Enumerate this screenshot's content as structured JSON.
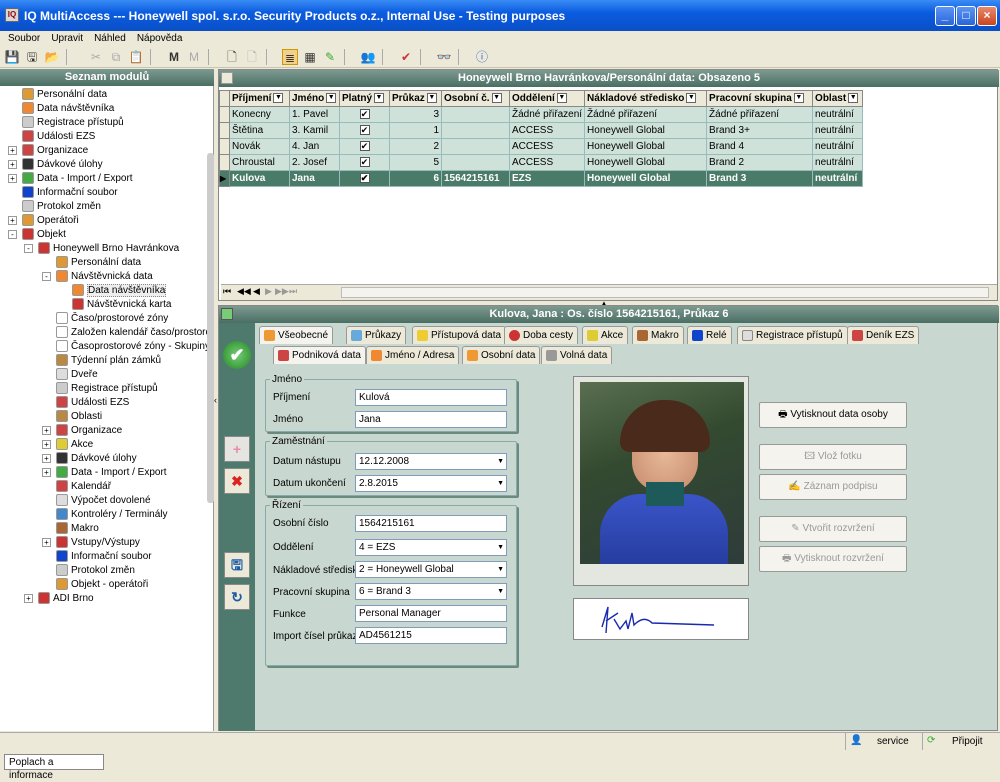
{
  "window": {
    "title": "IQ MultiAccess --- Honeywell spol. s.r.o. Security Products o.z., Internal Use - Testing purposes"
  },
  "menu": [
    "Soubor",
    "Upravit",
    "Náhled",
    "Nápověda"
  ],
  "left": {
    "header": "Seznam modulů",
    "items": [
      {
        "label": "Personální data"
      },
      {
        "label": "Data návštěvníka"
      },
      {
        "label": "Registrace přístupů"
      },
      {
        "label": "Události EZS"
      },
      {
        "label": "Organizace"
      },
      {
        "label": "Dávkové úlohy"
      },
      {
        "label": "Data - Import / Export"
      },
      {
        "label": "Informační soubor"
      },
      {
        "label": "Protokol změn"
      },
      {
        "label": "Operátoři"
      },
      {
        "label": "Objekt"
      },
      {
        "label": "Honeywell Brno Havránkova"
      },
      {
        "label": "Personální data"
      },
      {
        "label": "Návštěvnická data"
      },
      {
        "label": "Data návštěvníka"
      },
      {
        "label": "Návštěvnická karta"
      },
      {
        "label": "Časo/prostorové zóny"
      },
      {
        "label": "Založen kalendář časo/prostorov"
      },
      {
        "label": "Časoprostorové zóny - Skupiny"
      },
      {
        "label": "Týdenní plán zámků"
      },
      {
        "label": "Dveře"
      },
      {
        "label": "Registrace přístupů"
      },
      {
        "label": "Události EZS"
      },
      {
        "label": "Oblasti"
      },
      {
        "label": "Organizace"
      },
      {
        "label": "Akce"
      },
      {
        "label": "Dávkové úlohy"
      },
      {
        "label": "Data - Import / Export"
      },
      {
        "label": "Kalendář"
      },
      {
        "label": "Výpočet dovolené"
      },
      {
        "label": "Kontroléry / Terminály"
      },
      {
        "label": "Makro"
      },
      {
        "label": "Vstupy/Výstupy"
      },
      {
        "label": "Informační soubor"
      },
      {
        "label": "Protokol změn"
      },
      {
        "label": "Objekt - operátoři"
      },
      {
        "label": "ADI Brno"
      }
    ]
  },
  "grid": {
    "header": "Honeywell Brno Havránkova/Personální data: Obsazeno 5",
    "columns": [
      "Příjmení",
      "Jméno",
      "Platný",
      "Průkaz",
      "Osobní č.",
      "Oddělení",
      "Nákladové středisko",
      "Pracovní skupina",
      "Oblast"
    ],
    "rows": [
      [
        "Konecny",
        "1. Pavel",
        "✔",
        "3",
        "",
        "Žádné přiřazení",
        "Žádné přiřazení",
        "Žádné přiřazení",
        "neutrální"
      ],
      [
        "Štětina",
        "3. Kamil",
        "✔",
        "1",
        "",
        "ACCESS",
        "Honeywell Global",
        "Brand 3+",
        "neutrální"
      ],
      [
        "Novák",
        "4. Jan",
        "✔",
        "2",
        "",
        "ACCESS",
        "Honeywell Global",
        "Brand 4",
        "neutrální"
      ],
      [
        "Chroustal",
        "2. Josef",
        "✔",
        "5",
        "",
        "ACCESS",
        "Honeywell Global",
        "Brand 2",
        "neutrální"
      ],
      [
        "Kulova",
        "Jana",
        "✔",
        "6",
        "1564215161",
        "EZS",
        "Honeywell Global",
        "Brand 3",
        "neutrální"
      ]
    ]
  },
  "detail": {
    "header": "Kulova, Jana : Os. číslo 1564215161, Průkaz 6",
    "tabs_row1": [
      "Všeobecné",
      "Průkazy",
      "Přístupová data",
      "Doba cesty",
      "Akce",
      "Makro",
      "Relé",
      "Registrace přístupů",
      "Deník EZS"
    ],
    "tabs_row2": [
      "Podniková data",
      "Jméno / Adresa",
      "Osobní data",
      "Volná data"
    ],
    "jmeno": {
      "legend": "Jméno",
      "prijmeni_label": "Příjmení",
      "prijmeni": "Kulová",
      "jmeno_label": "Jméno",
      "jmeno": "Jana"
    },
    "zamestnani": {
      "legend": "Zaměstnání",
      "nastup_label": "Datum nástupu",
      "nastup": "12.12.2008",
      "ukonceni_label": "Datum ukončení",
      "ukonceni": "2.8.2015"
    },
    "rizeni": {
      "legend": "Řízení",
      "osobni_label": "Osobní číslo",
      "osobni": "1564215161",
      "oddeleni_label": "Oddělení",
      "oddeleni": "4 = EZS",
      "stredisko_label": "Nákladové středisk",
      "stredisko": "2 = Honeywell Global",
      "skupina_label": "Pracovní skupina",
      "skupina": "6 = Brand 3",
      "funkce_label": "Funkce",
      "funkce": "Personal Manager",
      "import_label": "Import čísel průkazů",
      "import": "AD4561215"
    },
    "buttons": {
      "tisk": "Vytisknout data osoby",
      "foto": "Vlož fotku",
      "podpis": "Záznam podpisu",
      "rozvrh": "Vtvořit rozvržení",
      "tisk_rozvrh": "Vytisknout rozvržení"
    }
  },
  "status": {
    "user": "service",
    "connect": "Připojit",
    "bottom": "Poplach a informace"
  }
}
